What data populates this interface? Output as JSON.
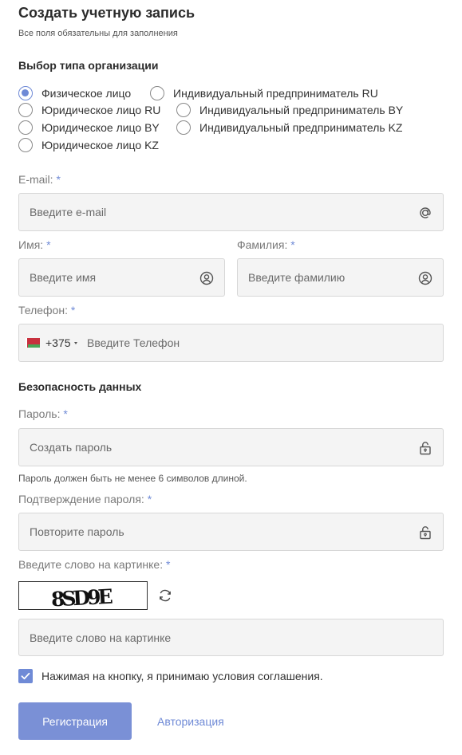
{
  "header": {
    "title": "Создать учетную запись",
    "subtitle": "Все поля обязательны для заполнения"
  },
  "org_type": {
    "heading": "Выбор типа организации",
    "options": [
      {
        "label": "Физическое лицо",
        "checked": true
      },
      {
        "label": "Индивидуальный предприниматель RU",
        "checked": false
      },
      {
        "label": "Юридическое лицо RU",
        "checked": false
      },
      {
        "label": "Индивидуальный предприниматель BY",
        "checked": false
      },
      {
        "label": "Юридическое лицо BY",
        "checked": false
      },
      {
        "label": "Индивидуальный предприниматель KZ",
        "checked": false
      },
      {
        "label": "Юридическое лицо KZ",
        "checked": false
      }
    ]
  },
  "required_mark": "*",
  "email": {
    "label": "E-mail:",
    "placeholder": "Введите e-mail",
    "icon": "at-sign-icon"
  },
  "first_name": {
    "label": "Имя:",
    "placeholder": "Введите имя",
    "icon": "user-circle-icon"
  },
  "last_name": {
    "label": "Фамилия:",
    "placeholder": "Введите фамилию",
    "icon": "user-circle-icon"
  },
  "phone": {
    "label": "Телефон:",
    "placeholder": "Введите Телефон",
    "country_code": "+375",
    "flag": "belarus-flag-icon"
  },
  "security": {
    "heading": "Безопасность данных",
    "password": {
      "label": "Пароль:",
      "placeholder": "Создать пароль",
      "hint": "Пароль должен быть не менее 6 символов длиной.",
      "icon": "lock-icon"
    },
    "confirm": {
      "label": "Подтверждение пароля:",
      "placeholder": "Повторите пароль",
      "icon": "lock-icon"
    }
  },
  "captcha": {
    "label": "Введите слово на картинке:",
    "image_text": "8SD9E",
    "placeholder": "Введите слово на картинке",
    "refresh_icon": "refresh-icon"
  },
  "agreement": {
    "text": "Нажимая на кнопку, я принимаю условия соглашения.",
    "checked": true
  },
  "actions": {
    "register": "Регистрация",
    "login": "Авторизация"
  },
  "colors": {
    "accent": "#6f8ad6",
    "button": "#7a90d6",
    "field_bg": "#f4f4f4",
    "field_border": "#d7d7d7"
  }
}
